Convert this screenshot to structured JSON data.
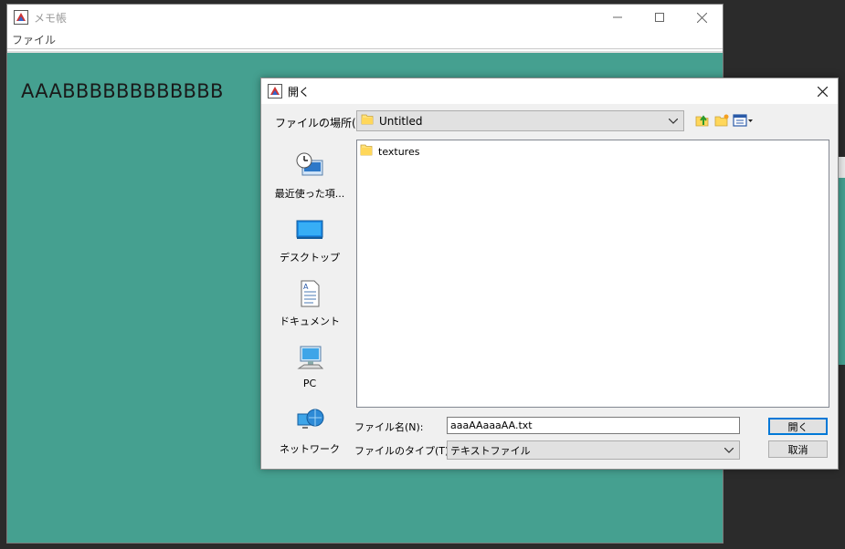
{
  "main_window": {
    "title": "メモ帳",
    "menu": [
      "ファイル"
    ],
    "content_text": "AAABBBBBBBBBBBB",
    "controls": {
      "minimize": "—",
      "maximize": "☐",
      "close": "✕"
    },
    "background_color": "#45a090"
  },
  "dialog": {
    "title": "開く",
    "close": "✕",
    "lookin_label": "ファイルの場所(I):",
    "lookin_value": "Untitled",
    "toolbar_icons": [
      "up-folder-icon",
      "new-folder-icon",
      "view-menu-icon"
    ],
    "places": [
      {
        "label": "最近使った項...",
        "icon": "recent-items-icon"
      },
      {
        "label": "デスクトップ",
        "icon": "desktop-icon"
      },
      {
        "label": "ドキュメント",
        "icon": "documents-icon"
      },
      {
        "label": "PC",
        "icon": "pc-icon"
      },
      {
        "label": "ネットワーク",
        "icon": "network-icon"
      }
    ],
    "files": [
      {
        "name": "textures",
        "type": "folder"
      }
    ],
    "filename_label": "ファイル名(N):",
    "filename_value": "aaaAAaaaAA.txt",
    "filetype_label": "ファイルのタイプ(T):",
    "filetype_value": "テキストファイル",
    "open_button": "開く",
    "cancel_button": "取消"
  },
  "colors": {
    "accent": "#0078d7",
    "teal": "#45a090"
  }
}
